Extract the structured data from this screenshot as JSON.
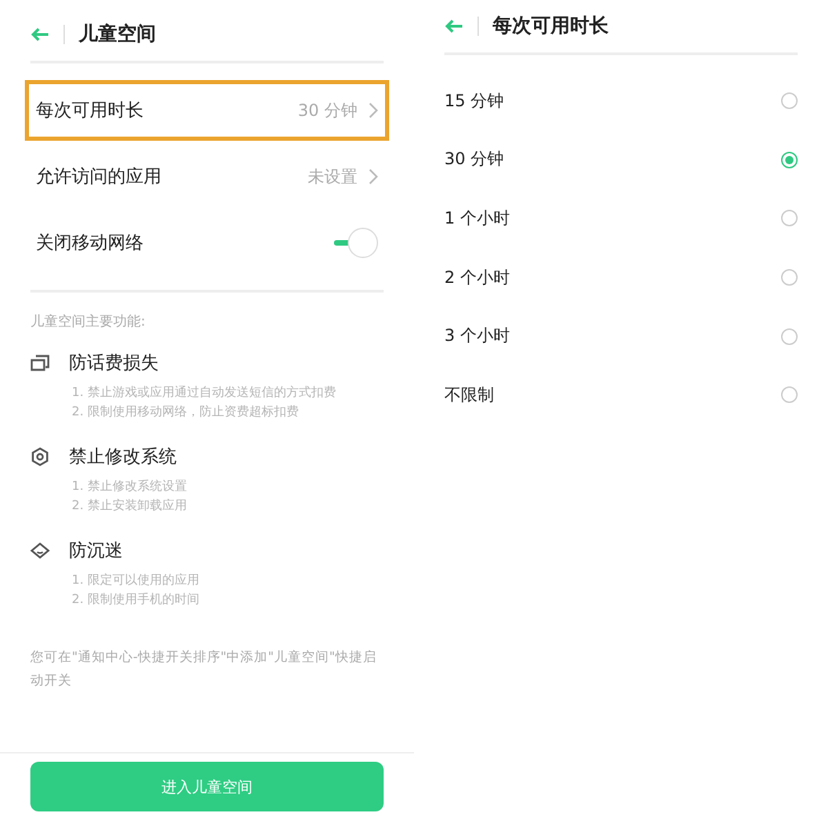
{
  "left_screen": {
    "title": "儿童空间",
    "settings": [
      {
        "kind": "link",
        "label": "每次可用时长",
        "value": "30 分钟",
        "highlighted": true
      },
      {
        "kind": "link",
        "label": "允许访问的应用",
        "value": "未设置",
        "highlighted": false
      },
      {
        "kind": "toggle",
        "label": "关闭移动网络",
        "on": true,
        "highlighted": false
      }
    ],
    "features_heading": "儿童空间主要功能:",
    "features": [
      {
        "title": "防话费损失",
        "points": [
          "1. 禁止游戏或应用通过自动发送短信的方式扣费",
          "2. 限制使用移动网络，防止资费超标扣费"
        ]
      },
      {
        "title": "禁止修改系统",
        "points": [
          "1. 禁止修改系统设置",
          "2. 禁止安装卸载应用"
        ]
      },
      {
        "title": "防沉迷",
        "points": [
          "1. 限定可以使用的应用",
          "2. 限制使用手机的时间"
        ]
      }
    ],
    "note": "您可在\"通知中心-快捷开关排序\"中添加\"儿童空间\"快捷启动开关",
    "button": "进入儿童空间"
  },
  "right_screen": {
    "title": "每次可用时长",
    "options": [
      {
        "label": "15 分钟",
        "selected": false
      },
      {
        "label": "30 分钟",
        "selected": true
      },
      {
        "label": "1 个小时",
        "selected": false
      },
      {
        "label": "2 个小时",
        "selected": false
      },
      {
        "label": "3 个小时",
        "selected": false
      },
      {
        "label": "不限制",
        "selected": false
      }
    ]
  }
}
